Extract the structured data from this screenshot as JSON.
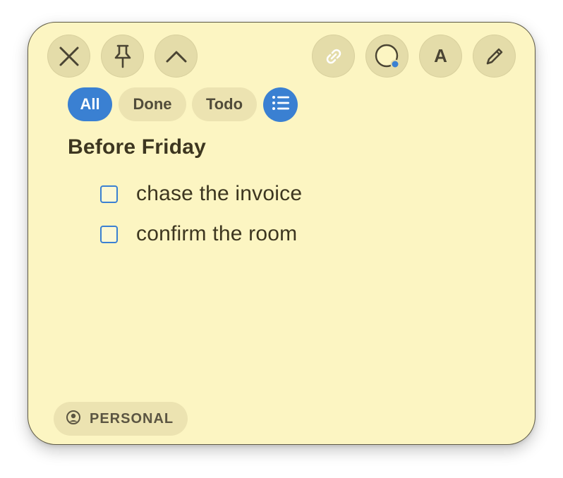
{
  "toolbar": {
    "left_buttons": [
      {
        "icon": "close-icon"
      },
      {
        "icon": "pin-icon"
      },
      {
        "icon": "chevron-up-icon"
      }
    ],
    "right_buttons": [
      {
        "icon": "link-icon"
      },
      {
        "icon": "color-picker-icon"
      },
      {
        "icon": "font-icon",
        "label": "A"
      },
      {
        "icon": "pencil-icon"
      }
    ]
  },
  "filters": {
    "all_label": "All",
    "done_label": "Done",
    "todo_label": "Todo",
    "selected": "All",
    "list_icon": "list-icon"
  },
  "note": {
    "title": "Before Friday",
    "items": [
      {
        "text": "chase the invoice",
        "checked": false
      },
      {
        "text": "confirm the room",
        "checked": false
      }
    ]
  },
  "tag": {
    "icon": "person-circle-icon",
    "label": "PERSONAL"
  },
  "colors": {
    "note_background": "#fcf5c2",
    "button_background": "#e4dca9",
    "accent": "#3a80d2",
    "text": "#3d3620"
  }
}
